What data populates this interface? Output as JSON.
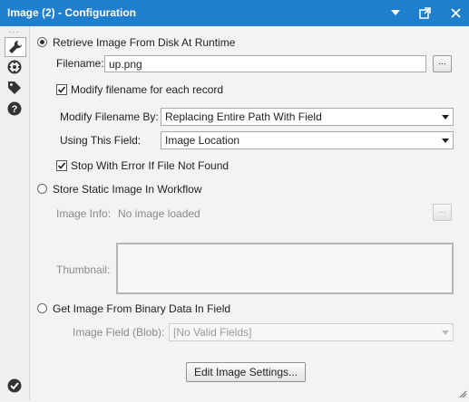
{
  "window": {
    "title": "Image (2) - Configuration"
  },
  "sidebar": {
    "items": [
      {
        "icon": "wrench-icon"
      },
      {
        "icon": "connection-icon"
      },
      {
        "icon": "tag-icon"
      },
      {
        "icon": "help-icon"
      }
    ],
    "status_icon": "checkmark-icon"
  },
  "options": {
    "retrieve": {
      "label": "Retrieve Image From Disk At Runtime",
      "selected": true,
      "filename_label": "Filename:",
      "filename_value": "up.png",
      "browse_label": "...",
      "modify_label": "Modify filename for each record",
      "modify_checked": true,
      "modify_by_label": "Modify Filename By:",
      "modify_by_value": "Replacing Entire Path With Field",
      "using_field_label": "Using This Field:",
      "using_field_value": "Image Location",
      "stop_label": "Stop With Error If File Not Found",
      "stop_checked": true
    },
    "static": {
      "label": "Store Static Image In Workflow",
      "selected": false,
      "image_info_label": "Image Info:",
      "image_info_value": "No image loaded",
      "browse_label": "...",
      "thumbnail_label": "Thumbnail:"
    },
    "binary": {
      "label": "Get Image From Binary Data In Field",
      "selected": false,
      "field_label": "Image Field (Blob):",
      "field_value": "[No Valid Fields]"
    }
  },
  "edit_button_label": "Edit Image Settings..."
}
